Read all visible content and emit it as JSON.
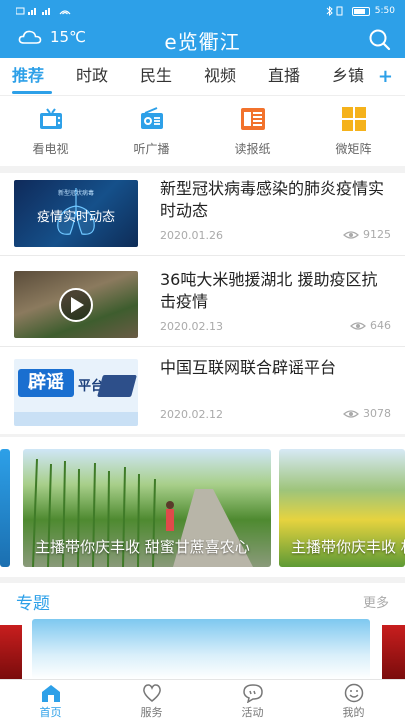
{
  "status_bar": {
    "left": "₲´δ´",
    "time": "5:50"
  },
  "header": {
    "temperature": "15℃",
    "title": "e览衢江"
  },
  "tabs": [
    {
      "label": "推荐",
      "active": true
    },
    {
      "label": "时政"
    },
    {
      "label": "民生"
    },
    {
      "label": "视频"
    },
    {
      "label": "直播"
    },
    {
      "label": "乡镇"
    }
  ],
  "tab_add": "+",
  "quick_links": [
    {
      "label": "看电视",
      "icon": "tv-icon"
    },
    {
      "label": "听广播",
      "icon": "radio-icon"
    },
    {
      "label": "读报纸",
      "icon": "newspaper-icon"
    },
    {
      "label": "微矩阵",
      "icon": "grid-icon"
    }
  ],
  "news": [
    {
      "title": "新型冠状病毒感染的肺炎疫情实时动态",
      "date": "2020.01.26",
      "views": "9125",
      "thumb_text": "疫情实时动态",
      "thumb_small": "新型冠状病毒"
    },
    {
      "title": "36吨大米驰援湖北 援助疫区抗击疫情",
      "date": "2020.02.13",
      "views": "646"
    },
    {
      "title": "中国互联网联合辟谣平台",
      "date": "2020.02.12",
      "views": "3078",
      "thumb_text": "辟谣",
      "thumb_text2": "平台"
    }
  ],
  "carousel": [
    {
      "caption": "主播带你庆丰收 甜蜜甘蔗喜农心"
    },
    {
      "caption": "主播带你庆丰收 机稻迎来大丰收"
    }
  ],
  "topics": {
    "title": "专题",
    "more": "更多"
  },
  "bottom_nav": [
    {
      "label": "首页",
      "active": true
    },
    {
      "label": "服务"
    },
    {
      "label": "活动"
    },
    {
      "label": "我的"
    }
  ],
  "colors": {
    "brand": "#2da0e8",
    "text": "#222222",
    "muted": "#aaaaaa"
  }
}
